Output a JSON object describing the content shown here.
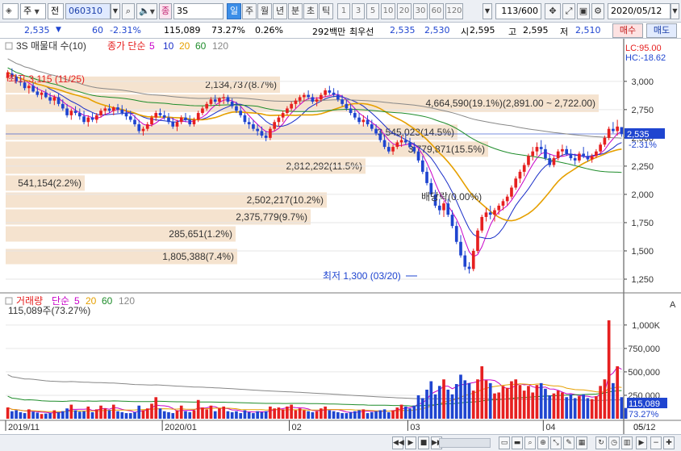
{
  "toolbar": {
    "market_type": "주",
    "market_sel": "전",
    "stock_code": "060310",
    "sound_icon": "speaker-icon",
    "badge": "종",
    "stock_name": "3S",
    "period_tabs": [
      "일",
      "주",
      "월",
      "년",
      "분",
      "초",
      "틱"
    ],
    "active_period": "일",
    "interval_buttons": [
      "1",
      "3",
      "5",
      "10",
      "20",
      "30",
      "60",
      "120"
    ],
    "count": "113/600",
    "date": "2020/05/12"
  },
  "info": {
    "price": "2,535",
    "price_arrow": "▼",
    "change": "60",
    "change_pct": "-2.31%",
    "volume": "115,089",
    "ratio": "73.27%",
    "turnover": "0.26%",
    "amount": "292백만",
    "quote_label": "최우선",
    "ask": "2,535",
    "bid": "2,530",
    "open_label": "시",
    "open": "2,595",
    "high_label": "고",
    "high": "2,595",
    "low_label": "저",
    "low": "2,510",
    "buy_label": "매수",
    "sell_label": "매도"
  },
  "colors": {
    "up": "#e62020",
    "down": "#1f45d0",
    "ma5": "#c800c8",
    "ma10": "#1a2ec8",
    "ma20": "#e6a000",
    "ma60": "#1e8c2a",
    "ma120": "#888888",
    "band": "#f5e3cf",
    "accent": "#3c8ee8"
  },
  "chart_data": {
    "type": "candlestick",
    "title": "3S 매물대 수(10)",
    "ma_label": "종가 단순",
    "ma_periods": [
      "5",
      "10",
      "20",
      "60",
      "120"
    ],
    "limit_high": "LC:95.00",
    "limit_high2": "HC:-18.62",
    "current_price_label": "2,535",
    "current_change_label": "-2.31%",
    "y_ticks": [
      "3,000",
      "2,750",
      "2,500",
      "2,250",
      "2,000",
      "1,750",
      "1,500",
      "1,250"
    ],
    "y_tick_values": [
      3000,
      2750,
      2500,
      2250,
      2000,
      1750,
      1500,
      1250
    ],
    "ylim": [
      1150,
      3320
    ],
    "high_label": "최고 3,115 (11/25)",
    "low_label": "최저 1,300 (03/20)",
    "dividend_label": "배당락(0.00%)",
    "volume_profile": [
      {
        "label": "1,805,388(7.4%)",
        "price_range": [
          1375,
          1525
        ]
      },
      {
        "label": "285,651(1.2%)",
        "price_range": [
          1575,
          1725
        ]
      },
      {
        "label": "2,375,779(9.7%)",
        "price_range": [
          1725,
          1875
        ]
      },
      {
        "label": "2,502,217(10.2%)",
        "price_range": [
          1875,
          2025
        ]
      },
      {
        "label": "541,154(2.2%)",
        "price_range": [
          2025,
          2175
        ]
      },
      {
        "label": "2,812,292(11.5%)",
        "price_range": [
          2175,
          2325
        ]
      },
      {
        "label": "3,779,871(15.5%)",
        "price_range": [
          2325,
          2475
        ]
      },
      {
        "label": "3,545,023(14.5%)",
        "price_range": [
          2475,
          2625
        ]
      },
      {
        "label": "4,664,590(19.1%)(2,891.00 ~ 2,722.00)",
        "price_range": [
          2722,
          2891
        ]
      },
      {
        "label": "2,134,737(8.7%)",
        "price_range": [
          2891,
          3050
        ]
      }
    ],
    "volume_title": "거래량",
    "volume_ma_label": "단순",
    "volume_ma_periods": [
      "5",
      "20",
      "60",
      "120"
    ],
    "volume_value_label": "115,089주(73.27%)",
    "volume_badge": "115,089",
    "volume_badge2": "73.27%",
    "volume_ticks": [
      "1,000K",
      "750,000",
      "500,000",
      "250,000"
    ],
    "volume_tick_values": [
      1000000,
      750000,
      500000,
      250000
    ],
    "volume_ylim": [
      0,
      1300000
    ],
    "x_labels": [
      "2019/11",
      "2020/01",
      "02",
      "03",
      "04",
      "05",
      "05/12"
    ],
    "x_label_index": [
      0,
      37,
      67,
      95,
      127,
      156,
      175
    ],
    "candles": [
      [
        3030,
        3100,
        3000,
        3080
      ],
      [
        3070,
        3115,
        3020,
        3040
      ],
      [
        3040,
        3060,
        2980,
        3000
      ],
      [
        3000,
        3050,
        2960,
        2990
      ],
      [
        2990,
        3010,
        2920,
        2940
      ],
      [
        2940,
        2980,
        2890,
        2960
      ],
      [
        2960,
        2990,
        2900,
        2910
      ],
      [
        2910,
        2950,
        2860,
        2880
      ],
      [
        2880,
        2920,
        2840,
        2900
      ],
      [
        2900,
        2930,
        2850,
        2860
      ],
      [
        2860,
        2900,
        2800,
        2830
      ],
      [
        2830,
        2880,
        2790,
        2860
      ],
      [
        2860,
        2890,
        2780,
        2800
      ],
      [
        2800,
        2840,
        2740,
        2760
      ],
      [
        2760,
        2800,
        2680,
        2700
      ],
      [
        2700,
        2760,
        2660,
        2740
      ],
      [
        2740,
        2780,
        2700,
        2720
      ],
      [
        2720,
        2760,
        2660,
        2690
      ],
      [
        2690,
        2740,
        2620,
        2640
      ],
      [
        2640,
        2700,
        2600,
        2680
      ],
      [
        2680,
        2720,
        2640,
        2660
      ],
      [
        2660,
        2720,
        2630,
        2700
      ],
      [
        2700,
        2760,
        2680,
        2740
      ],
      [
        2740,
        2780,
        2700,
        2760
      ],
      [
        2760,
        2800,
        2720,
        2740
      ],
      [
        2740,
        2780,
        2700,
        2770
      ],
      [
        2770,
        2800,
        2720,
        2750
      ],
      [
        2750,
        2790,
        2700,
        2720
      ],
      [
        2720,
        2760,
        2660,
        2690
      ],
      [
        2690,
        2740,
        2640,
        2660
      ],
      [
        2660,
        2700,
        2600,
        2620
      ],
      [
        2620,
        2660,
        2540,
        2560
      ],
      [
        2560,
        2600,
        2520,
        2580
      ],
      [
        2580,
        2640,
        2560,
        2620
      ],
      [
        2620,
        2700,
        2600,
        2680
      ],
      [
        2680,
        2740,
        2650,
        2720
      ],
      [
        2720,
        2760,
        2680,
        2700
      ],
      [
        2700,
        2740,
        2660,
        2680
      ],
      [
        2680,
        2720,
        2620,
        2640
      ],
      [
        2640,
        2680,
        2580,
        2600
      ],
      [
        2600,
        2660,
        2560,
        2640
      ],
      [
        2640,
        2700,
        2620,
        2680
      ],
      [
        2680,
        2720,
        2640,
        2660
      ],
      [
        2660,
        2700,
        2600,
        2620
      ],
      [
        2620,
        2680,
        2600,
        2660
      ],
      [
        2660,
        2740,
        2640,
        2720
      ],
      [
        2720,
        2780,
        2700,
        2760
      ],
      [
        2760,
        2820,
        2740,
        2800
      ],
      [
        2800,
        2860,
        2780,
        2840
      ],
      [
        2840,
        2880,
        2800,
        2820
      ],
      [
        2820,
        2860,
        2780,
        2850
      ],
      [
        2850,
        2890,
        2800,
        2860
      ],
      [
        2860,
        2880,
        2800,
        2820
      ],
      [
        2820,
        2850,
        2760,
        2780
      ],
      [
        2780,
        2820,
        2720,
        2740
      ],
      [
        2740,
        2780,
        2680,
        2700
      ],
      [
        2700,
        2720,
        2620,
        2640
      ],
      [
        2640,
        2680,
        2580,
        2620
      ],
      [
        2620,
        2660,
        2560,
        2580
      ],
      [
        2580,
        2620,
        2520,
        2560
      ],
      [
        2560,
        2600,
        2500,
        2520
      ],
      [
        2520,
        2560,
        2470,
        2500
      ],
      [
        2500,
        2600,
        2480,
        2580
      ],
      [
        2580,
        2660,
        2560,
        2640
      ],
      [
        2640,
        2700,
        2600,
        2680
      ],
      [
        2680,
        2740,
        2640,
        2720
      ],
      [
        2720,
        2780,
        2700,
        2760
      ],
      [
        2760,
        2820,
        2740,
        2800
      ],
      [
        2800,
        2850,
        2760,
        2830
      ],
      [
        2830,
        2880,
        2800,
        2860
      ],
      [
        2860,
        2900,
        2820,
        2880
      ],
      [
        2880,
        2920,
        2840,
        2860
      ],
      [
        2860,
        2890,
        2800,
        2820
      ],
      [
        2820,
        2860,
        2780,
        2840
      ],
      [
        2840,
        2900,
        2820,
        2880
      ],
      [
        2880,
        2940,
        2860,
        2920
      ],
      [
        2920,
        2960,
        2880,
        2900
      ],
      [
        2900,
        2940,
        2860,
        2880
      ],
      [
        2880,
        2920,
        2820,
        2840
      ],
      [
        2840,
        2880,
        2780,
        2800
      ],
      [
        2800,
        2840,
        2740,
        2760
      ],
      [
        2760,
        2800,
        2700,
        2720
      ],
      [
        2720,
        2760,
        2660,
        2680
      ],
      [
        2680,
        2720,
        2620,
        2640
      ],
      [
        2640,
        2700,
        2600,
        2660
      ],
      [
        2660,
        2700,
        2600,
        2620
      ],
      [
        2620,
        2660,
        2560,
        2580
      ],
      [
        2580,
        2620,
        2520,
        2540
      ],
      [
        2540,
        2580,
        2460,
        2480
      ],
      [
        2480,
        2520,
        2400,
        2420
      ],
      [
        2420,
        2460,
        2360,
        2380
      ],
      [
        2380,
        2440,
        2350,
        2420
      ],
      [
        2420,
        2480,
        2400,
        2460
      ],
      [
        2460,
        2520,
        2420,
        2480
      ],
      [
        2480,
        2540,
        2440,
        2460
      ],
      [
        2460,
        2500,
        2400,
        2420
      ],
      [
        2420,
        2460,
        2360,
        2380
      ],
      [
        2380,
        2400,
        2280,
        2300
      ],
      [
        2300,
        2340,
        2180,
        2200
      ],
      [
        2200,
        2240,
        2080,
        2100
      ],
      [
        2100,
        2140,
        1980,
        2000
      ],
      [
        2000,
        2040,
        1880,
        1900
      ],
      [
        1900,
        1960,
        1820,
        1860
      ],
      [
        1860,
        1940,
        1800,
        1920
      ],
      [
        1920,
        1960,
        1800,
        1820
      ],
      [
        1820,
        1860,
        1700,
        1720
      ],
      [
        1720,
        1760,
        1560,
        1580
      ],
      [
        1580,
        1640,
        1440,
        1460
      ],
      [
        1460,
        1500,
        1330,
        1360
      ],
      [
        1360,
        1400,
        1300,
        1340
      ],
      [
        1340,
        1520,
        1320,
        1500
      ],
      [
        1500,
        1700,
        1480,
        1680
      ],
      [
        1680,
        1820,
        1660,
        1800
      ],
      [
        1800,
        1880,
        1760,
        1840
      ],
      [
        1840,
        1900,
        1780,
        1820
      ],
      [
        1820,
        1880,
        1760,
        1860
      ],
      [
        1860,
        1920,
        1820,
        1900
      ],
      [
        1900,
        1960,
        1860,
        1940
      ],
      [
        1940,
        2000,
        1900,
        1980
      ],
      [
        1980,
        2080,
        1960,
        2060
      ],
      [
        2060,
        2160,
        2040,
        2140
      ],
      [
        2140,
        2220,
        2100,
        2200
      ],
      [
        2200,
        2280,
        2160,
        2260
      ],
      [
        2260,
        2360,
        2240,
        2340
      ],
      [
        2340,
        2420,
        2300,
        2380
      ],
      [
        2380,
        2460,
        2340,
        2420
      ],
      [
        2420,
        2480,
        2360,
        2400
      ],
      [
        2400,
        2440,
        2300,
        2320
      ],
      [
        2320,
        2360,
        2240,
        2260
      ],
      [
        2260,
        2340,
        2240,
        2320
      ],
      [
        2320,
        2400,
        2300,
        2380
      ],
      [
        2380,
        2440,
        2340,
        2400
      ],
      [
        2400,
        2430,
        2340,
        2360
      ],
      [
        2360,
        2400,
        2300,
        2320
      ],
      [
        2320,
        2360,
        2260,
        2300
      ],
      [
        2300,
        2380,
        2280,
        2360
      ],
      [
        2360,
        2420,
        2320,
        2340
      ],
      [
        2340,
        2380,
        2290,
        2310
      ],
      [
        2310,
        2360,
        2280,
        2340
      ],
      [
        2340,
        2400,
        2320,
        2380
      ],
      [
        2380,
        2460,
        2360,
        2440
      ],
      [
        2440,
        2520,
        2420,
        2500
      ],
      [
        2500,
        2600,
        2480,
        2580
      ],
      [
        2580,
        2640,
        2540,
        2560
      ],
      [
        2560,
        2660,
        2520,
        2600
      ],
      [
        2595,
        2595,
        2510,
        2535
      ]
    ],
    "volumes": [
      120000,
      80000,
      90000,
      70000,
      60000,
      100000,
      75000,
      65000,
      50000,
      55000,
      60000,
      90000,
      70000,
      80000,
      110000,
      150000,
      90000,
      75000,
      80000,
      130000,
      70000,
      100000,
      140000,
      110000,
      90000,
      150000,
      80000,
      70000,
      60000,
      60000,
      70000,
      140000,
      90000,
      110000,
      160000,
      230000,
      110000,
      80000,
      70000,
      60000,
      90000,
      140000,
      80000,
      70000,
      90000,
      200000,
      120000,
      100000,
      140000,
      80000,
      110000,
      130000,
      80000,
      70000,
      80000,
      60000,
      90000,
      70000,
      60000,
      80000,
      70000,
      80000,
      130000,
      110000,
      120000,
      100000,
      130000,
      150000,
      90000,
      110000,
      90000,
      80000,
      70000,
      80000,
      110000,
      130000,
      90000,
      80000,
      70000,
      60000,
      60000,
      70000,
      80000,
      90000,
      100000,
      60000,
      70000,
      80000,
      90000,
      100000,
      70000,
      90000,
      120000,
      150000,
      130000,
      110000,
      140000,
      250000,
      220000,
      310000,
      400000,
      260000,
      350000,
      420000,
      310000,
      260000,
      370000,
      470000,
      410000,
      380000,
      300000,
      420000,
      560000,
      410000,
      380000,
      270000,
      280000,
      350000,
      330000,
      400000,
      420000,
      360000,
      300000,
      350000,
      280000,
      360000,
      380000,
      320000,
      250000,
      270000,
      300000,
      280000,
      230000,
      260000,
      220000,
      240000,
      260000,
      220000,
      210000,
      240000,
      350000,
      420000,
      1050000,
      380000,
      560000,
      230000,
      115089
    ],
    "volume_up": [
      1,
      0,
      0,
      0,
      0,
      1,
      0,
      0,
      1,
      0,
      0,
      1,
      0,
      0,
      0,
      1,
      0,
      0,
      0,
      1,
      0,
      1,
      1,
      1,
      0,
      1,
      0,
      0,
      0,
      0,
      0,
      0,
      1,
      1,
      1,
      1,
      0,
      0,
      0,
      0,
      1,
      1,
      0,
      0,
      1,
      1,
      1,
      1,
      1,
      0,
      1,
      1,
      0,
      0,
      0,
      0,
      0,
      0,
      0,
      0,
      0,
      0,
      1,
      1,
      1,
      1,
      1,
      1,
      1,
      1,
      1,
      0,
      0,
      1,
      1,
      1,
      0,
      0,
      0,
      0,
      0,
      0,
      0,
      0,
      1,
      0,
      0,
      0,
      0,
      0,
      0,
      1,
      1,
      1,
      0,
      0,
      0,
      0,
      0,
      0,
      0,
      0,
      0,
      1,
      0,
      0,
      0,
      0,
      0,
      0,
      1,
      1,
      1,
      1,
      0,
      1,
      1,
      1,
      1,
      1,
      1,
      1,
      1,
      1,
      1,
      1,
      0,
      0,
      0,
      1,
      1,
      1,
      0,
      0,
      0,
      1,
      0,
      0,
      1,
      1,
      1,
      1,
      1,
      0,
      1,
      0
    ]
  },
  "status": {
    "nav_buttons": [
      "◀◀",
      "▶",
      "■",
      "▶▶"
    ]
  }
}
